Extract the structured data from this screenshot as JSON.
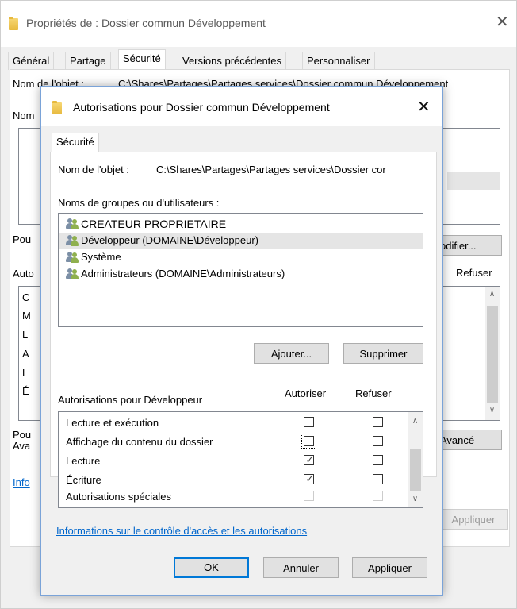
{
  "outer": {
    "title": "Propriétés de : Dossier commun Développement",
    "tabs": [
      "Général",
      "Partage",
      "Sécurité",
      "Versions précédentes",
      "Personnaliser"
    ],
    "object_label": "Nom de l'objet :",
    "object_path": "C:\\Shares\\Partages\\Partages services\\Dossier commun Développement",
    "groups_label_partial": "Nom",
    "perm_text_partial": "Pou",
    "edit_button_partial": "odifier...",
    "autor_label_partial": "Auto",
    "deny_header": "Refuser",
    "list_letters": [
      "C",
      "M",
      "L",
      "A",
      "L",
      "É"
    ],
    "special_text_partial": [
      "Pou",
      "Ava"
    ],
    "advanced_button_partial": "Avancé",
    "info_link_partial": "Info",
    "apply_button": "Appliquer"
  },
  "dialog": {
    "title": "Autorisations pour Dossier commun Développement",
    "tab": "Sécurité",
    "object_label": "Nom de l'objet :",
    "object_path": "C:\\Shares\\Partages\\Partages services\\Dossier cor",
    "groups_label": "Noms de groupes ou d'utilisateurs :",
    "groups": [
      "CREATEUR PROPRIETAIRE",
      "Développeur (DOMAINE\\Développeur)",
      "Système",
      "Administrateurs (DOMAINE\\Administrateurs)"
    ],
    "add_button": "Ajouter...",
    "remove_button": "Supprimer",
    "perm_label": "Autorisations pour Développeur",
    "allow_header": "Autoriser",
    "deny_header": "Refuser",
    "permissions": [
      {
        "name": "Lecture et exécution"
      },
      {
        "name": "Affichage du contenu du dossier"
      },
      {
        "name": "Lecture"
      },
      {
        "name": "Écriture"
      },
      {
        "name": "Autorisations spéciales"
      }
    ],
    "checkmark": "✓",
    "info_link": "Informations sur le contrôle d'accès et les autorisations",
    "ok_button": "OK",
    "cancel_button": "Annuler",
    "apply_button": "Appliquer"
  }
}
